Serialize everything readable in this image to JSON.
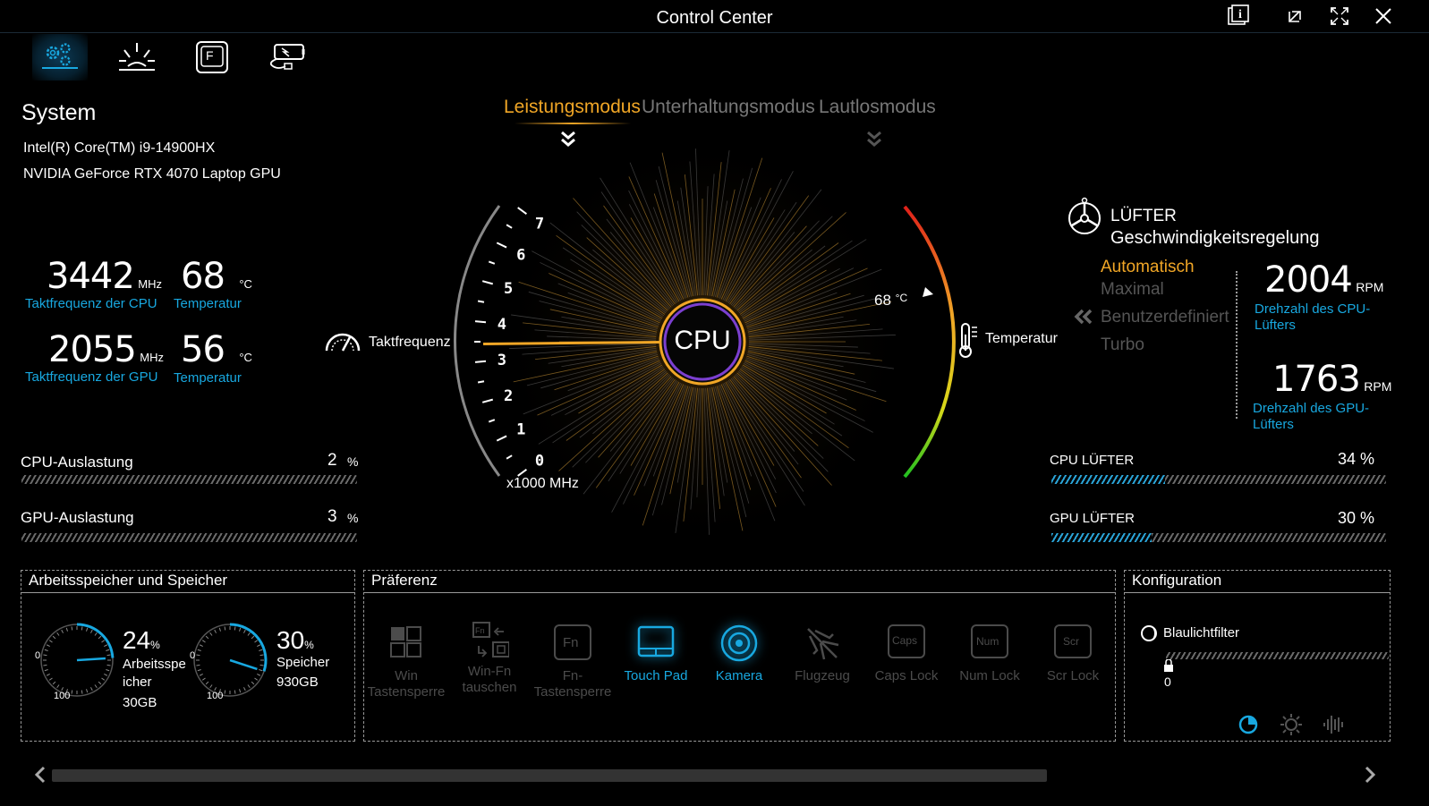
{
  "window": {
    "title": "Control Center"
  },
  "nav_tabs": [
    {
      "name": "system-settings",
      "active": true
    },
    {
      "name": "keyboard-light",
      "active": false
    },
    {
      "name": "fn-key",
      "active": false
    },
    {
      "name": "battery",
      "active": false
    }
  ],
  "system": {
    "title": "System",
    "cpu_name": "Intel(R) Core(TM) i9-14900HX",
    "gpu_name": "NVIDIA GeForce RTX 4070 Laptop GPU",
    "cpu_clock": "3442",
    "cpu_clock_unit": "MHz",
    "cpu_clock_label": "Taktfrequenz der CPU",
    "cpu_temp": "68",
    "cpu_temp_unit": "°C",
    "cpu_temp_label": "Temperatur",
    "gpu_clock": "2055",
    "gpu_clock_unit": "MHz",
    "gpu_clock_label": "Taktfrequenz der GPU",
    "gpu_temp": "56",
    "gpu_temp_unit": "°C",
    "gpu_temp_label": "Temperatur",
    "cpu_load_label": "CPU-Auslastung",
    "cpu_load": "2",
    "cpu_load_unit": "%",
    "gpu_load_label": "GPU-Auslastung",
    "gpu_load": "3",
    "gpu_load_unit": "%"
  },
  "modes": {
    "items": [
      "Leistungsmodus",
      "Unterhaltungsmodus",
      "Lautlosmodus"
    ],
    "active": "Leistungsmodus"
  },
  "gauge": {
    "center_label": "CPU",
    "left_label": "Taktfrequenz",
    "right_label": "Temperatur",
    "scale_unit": "x1000 MHz",
    "ticks": [
      "0",
      "1",
      "2",
      "3",
      "4",
      "5",
      "6",
      "7"
    ],
    "needle_value": 3.442,
    "temp_value": "68",
    "temp_unit": "°C",
    "accent_color": "#f0a626",
    "ring_color": "#7b3fd0"
  },
  "fan": {
    "title_line1": "LÜFTER",
    "title_line2": "Geschwindigkeitsregelung",
    "modes": [
      "Automatisch",
      "Maximal",
      "Benutzerdefiniert",
      "Turbo"
    ],
    "active_mode": "Automatisch",
    "cpu_rpm": "2004",
    "rpm_unit": "RPM",
    "cpu_rpm_label": "Drehzahl des CPU-Lüfters",
    "gpu_rpm": "1763",
    "gpu_rpm_label": "Drehzahl des GPU-Lüfters",
    "cpu_fan_label": "CPU LÜFTER",
    "cpu_fan_value": "34 %",
    "cpu_fan_percent": 34,
    "gpu_fan_label": "GPU LÜFTER",
    "gpu_fan_value": "30 %",
    "gpu_fan_percent": 30
  },
  "memory": {
    "title": "Arbeitsspeicher und Speicher",
    "ram_percent": "24",
    "ram_percent_value": 24,
    "ram_label_1": "Arbeitsspe",
    "ram_label_2": "icher",
    "ram_size": "30GB",
    "disk_percent": "30",
    "disk_percent_value": 30,
    "disk_label": "Speicher",
    "disk_size": "930GB",
    "pct_sign": "%",
    "scale_min": "0",
    "scale_max": "100"
  },
  "preferences": {
    "title": "Präferenz",
    "items": [
      {
        "l1": "Win",
        "l2": "Tastensperre",
        "on": false
      },
      {
        "l1": "Win-Fn",
        "l2": "tauschen",
        "on": false
      },
      {
        "l1": "Fn-",
        "l2": "Tastensperre",
        "on": false
      },
      {
        "l1": "Touch Pad",
        "l2": "",
        "on": true
      },
      {
        "l1": "Kamera",
        "l2": "",
        "on": true
      },
      {
        "l1": "Flugzeug",
        "l2": "",
        "on": false
      },
      {
        "l1": "Caps Lock",
        "l2": "",
        "on": false
      },
      {
        "l1": "Num Lock",
        "l2": "",
        "on": false
      },
      {
        "l1": "Scr Lock",
        "l2": "",
        "on": false
      }
    ],
    "key_glyphs": {
      "fn": "Fn",
      "caps": "Caps",
      "num": "Num",
      "scr": "Scr"
    }
  },
  "config": {
    "title": "Konfiguration",
    "bluelight_label": "Blaulichtfilter",
    "bluelight_value": "0"
  }
}
